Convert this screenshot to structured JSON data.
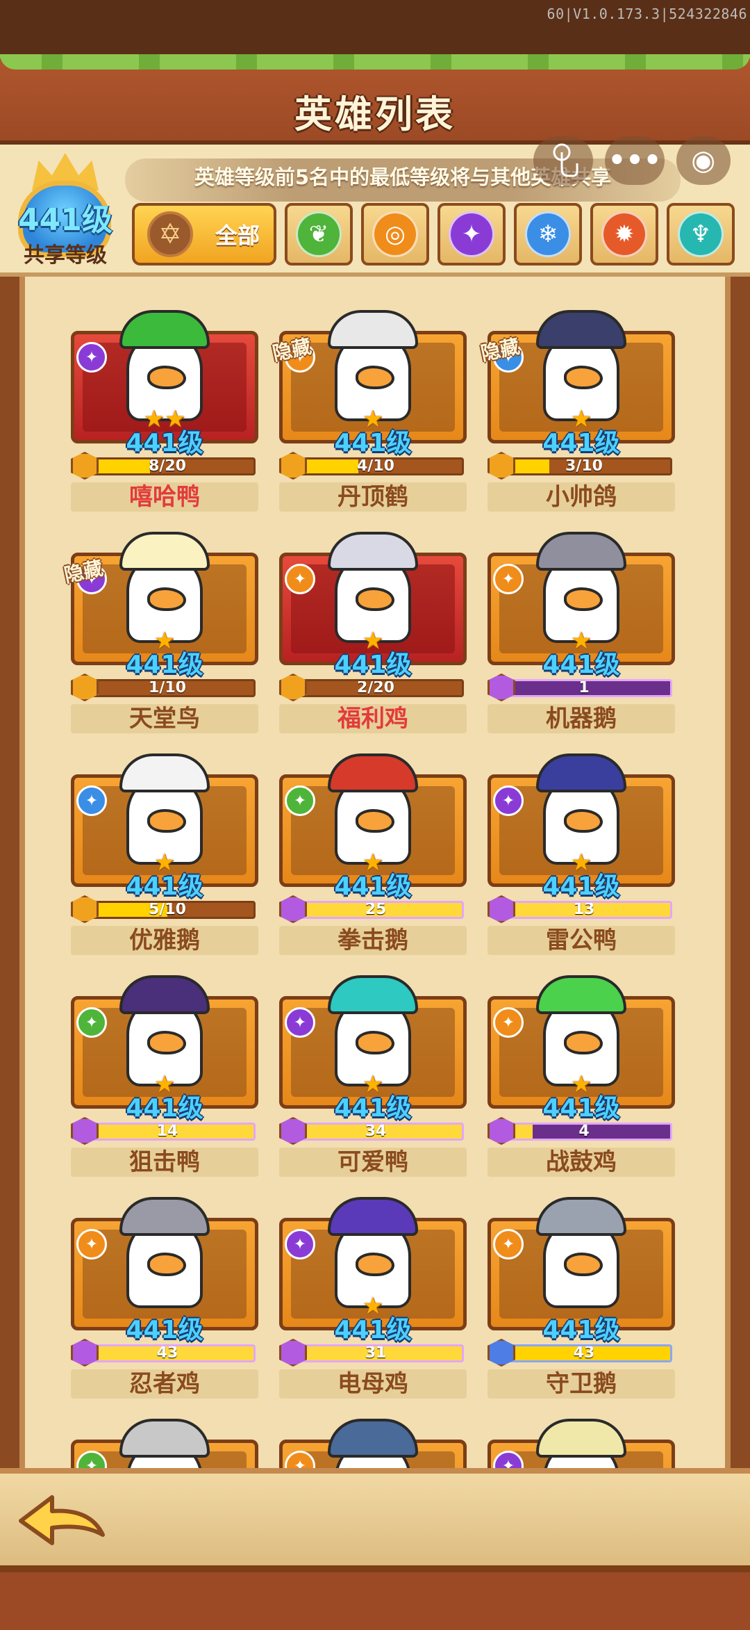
{
  "version": "60|V1.0.173.3|524322846",
  "title": "英雄列表",
  "hint": "英雄等级前5名中的最低等级将与其他英雄共享",
  "shared": {
    "level": "441级",
    "label": "共享等级"
  },
  "tabs": {
    "all_label": "全部",
    "elements": [
      {
        "name": "nature",
        "color": "#4fb43a",
        "glyph": "❦"
      },
      {
        "name": "sun",
        "color": "#f08c1a",
        "glyph": "◎"
      },
      {
        "name": "shadow",
        "color": "#8a3bd6",
        "glyph": "✦"
      },
      {
        "name": "ice",
        "color": "#3a8ee6",
        "glyph": "❄"
      },
      {
        "name": "fire",
        "color": "#e65a2a",
        "glyph": "✹"
      },
      {
        "name": "trident",
        "color": "#26b7b0",
        "glyph": "♆"
      }
    ]
  },
  "heroes": [
    {
      "name": "嘻哈鸭",
      "level": "441级",
      "progress": "8/20",
      "fill": 0.4,
      "stars": "★★",
      "frame": "red",
      "element": "#8a3bd6",
      "hidden": "",
      "bar": "orange",
      "nameColor": "red",
      "hat": "#3cba3c"
    },
    {
      "name": "丹顶鹤",
      "level": "441级",
      "progress": "4/10",
      "fill": 0.4,
      "stars": "★",
      "frame": "orange",
      "element": "#f08c1a",
      "hidden": "隐藏",
      "bar": "orange",
      "nameColor": "brown",
      "hat": "#e8e8e8"
    },
    {
      "name": "小帅鸽",
      "level": "441级",
      "progress": "3/10",
      "fill": 0.3,
      "stars": "★",
      "frame": "orange",
      "element": "#3a8ee6",
      "hidden": "隐藏",
      "bar": "orange",
      "nameColor": "brown",
      "hat": "#3a3f6b"
    },
    {
      "name": "天堂鸟",
      "level": "441级",
      "progress": "1/10",
      "fill": 0.1,
      "stars": "★",
      "frame": "orange",
      "element": "#8a3bd6",
      "hidden": "隐藏",
      "bar": "orange",
      "nameColor": "brown",
      "hat": "#fbf2c2"
    },
    {
      "name": "福利鸡",
      "level": "441级",
      "progress": "2/20",
      "fill": 0.1,
      "stars": "★",
      "frame": "red",
      "element": "#f08c1a",
      "hidden": "",
      "bar": "orange",
      "nameColor": "red",
      "hat": "#d9d9e6"
    },
    {
      "name": "机器鹅",
      "level": "441级",
      "progress": "1",
      "fill": 0.05,
      "stars": "★",
      "frame": "orange",
      "element": "#f08c1a",
      "hidden": "",
      "bar": "purple",
      "nameColor": "brown",
      "hat": "#8f8f9e"
    },
    {
      "name": "优雅鹅",
      "level": "441级",
      "progress": "5/10",
      "fill": 0.5,
      "stars": "★",
      "frame": "orange",
      "element": "#3a8ee6",
      "hidden": "",
      "bar": "orange",
      "nameColor": "brown",
      "hat": "#f3f3f3"
    },
    {
      "name": "拳击鹅",
      "level": "441级",
      "progress": "25",
      "fill": 1.0,
      "stars": "★",
      "frame": "orange",
      "element": "#4fb43a",
      "hidden": "",
      "bar": "purple",
      "nameColor": "brown",
      "hat": "#d63a2a"
    },
    {
      "name": "雷公鸭",
      "level": "441级",
      "progress": "13",
      "fill": 1.0,
      "stars": "★",
      "frame": "orange",
      "element": "#8a3bd6",
      "hidden": "",
      "bar": "purple",
      "nameColor": "brown",
      "hat": "#3a3f9e"
    },
    {
      "name": "狙击鸭",
      "level": "441级",
      "progress": "14",
      "fill": 1.0,
      "stars": "★",
      "frame": "orange",
      "element": "#4fb43a",
      "hidden": "",
      "bar": "purple",
      "nameColor": "brown",
      "hat": "#4a2f7a"
    },
    {
      "name": "可爱鸭",
      "level": "441级",
      "progress": "34",
      "fill": 1.0,
      "stars": "★",
      "frame": "orange",
      "element": "#8a3bd6",
      "hidden": "",
      "bar": "purple",
      "nameColor": "brown",
      "hat": "#2ec9c0"
    },
    {
      "name": "战鼓鸡",
      "level": "441级",
      "progress": "4",
      "fill": 0.2,
      "stars": "★",
      "frame": "orange",
      "element": "#f08c1a",
      "hidden": "",
      "bar": "purple",
      "nameColor": "brown",
      "hat": "#4cd14c"
    },
    {
      "name": "忍者鸡",
      "level": "441级",
      "progress": "43",
      "fill": 1.0,
      "stars": "",
      "frame": "orange",
      "element": "#f08c1a",
      "hidden": "",
      "bar": "purple",
      "nameColor": "brown",
      "hat": "#9a9aa6"
    },
    {
      "name": "电母鸡",
      "level": "441级",
      "progress": "31",
      "fill": 1.0,
      "stars": "★",
      "frame": "orange",
      "element": "#8a3bd6",
      "hidden": "",
      "bar": "purple",
      "nameColor": "brown",
      "hat": "#5a3ab8"
    },
    {
      "name": "守卫鹅",
      "level": "441级",
      "progress": "43",
      "fill": 1.0,
      "stars": "",
      "frame": "orange",
      "element": "#f08c1a",
      "hidden": "",
      "bar": "blue",
      "nameColor": "brown",
      "hat": "#9aa2b0"
    },
    {
      "name": "",
      "level": "",
      "progress": "",
      "fill": 0,
      "stars": "",
      "frame": "orange",
      "element": "#4fb43a",
      "hidden": "",
      "bar": "none",
      "nameColor": "brown",
      "hat": "#c8c8c8"
    },
    {
      "name": "",
      "level": "",
      "progress": "",
      "fill": 0,
      "stars": "",
      "frame": "orange",
      "element": "#f08c1a",
      "hidden": "",
      "bar": "none",
      "nameColor": "brown",
      "hat": "#4a6a9a"
    },
    {
      "name": "",
      "level": "",
      "progress": "",
      "fill": 0,
      "stars": "",
      "frame": "orange",
      "element": "#8a3bd6",
      "hidden": "",
      "bar": "none",
      "nameColor": "brown",
      "hat": "#f0e8a8"
    }
  ]
}
